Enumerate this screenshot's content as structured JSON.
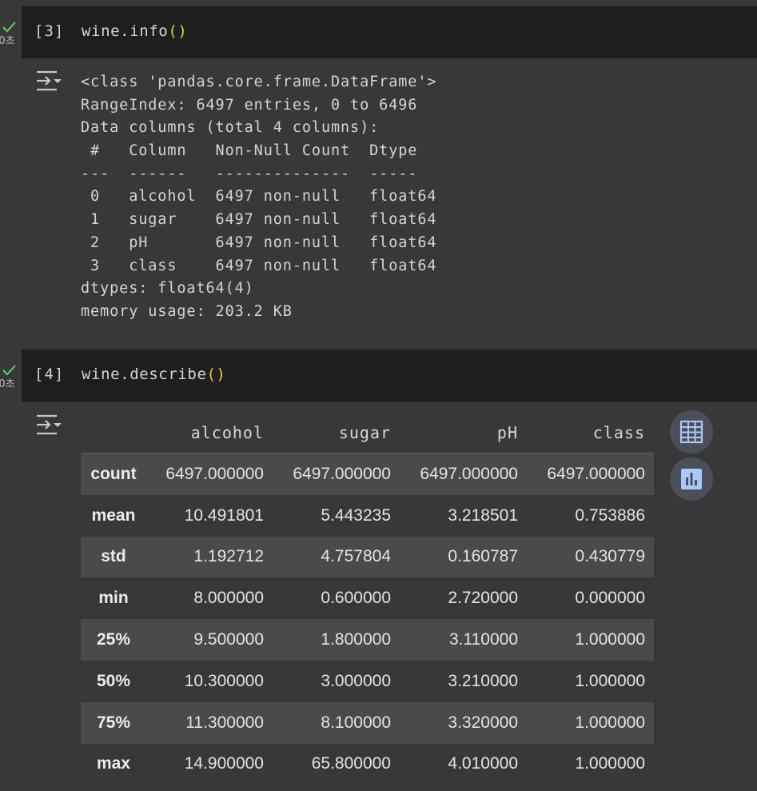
{
  "cells": [
    {
      "exec_count": "[3]",
      "exec_time": "0초",
      "code": {
        "prefix": "wine.info",
        "parens": "()"
      },
      "output_lines": [
        "<class 'pandas.core.frame.DataFrame'>",
        "RangeIndex: 6497 entries, 0 to 6496",
        "Data columns (total 4 columns):",
        " #   Column   Non-Null Count  Dtype  ",
        "---  ------   --------------  -----  ",
        " 0   alcohol  6497 non-null   float64",
        " 1   sugar    6497 non-null   float64",
        " 2   pH       6497 non-null   float64",
        " 3   class    6497 non-null   float64",
        "dtypes: float64(4)",
        "memory usage: 203.2 KB"
      ]
    },
    {
      "exec_count": "[4]",
      "exec_time": "0초",
      "code": {
        "prefix": "wine.describe",
        "parens": "()"
      }
    }
  ],
  "describe_table": {
    "columns": [
      "alcohol",
      "sugar",
      "pH",
      "class"
    ],
    "rows": [
      {
        "label": "count",
        "values": [
          "6497.000000",
          "6497.000000",
          "6497.000000",
          "6497.000000"
        ]
      },
      {
        "label": "mean",
        "values": [
          "10.491801",
          "5.443235",
          "3.218501",
          "0.753886"
        ]
      },
      {
        "label": "std",
        "values": [
          "1.192712",
          "4.757804",
          "0.160787",
          "0.430779"
        ]
      },
      {
        "label": "min",
        "values": [
          "8.000000",
          "0.600000",
          "2.720000",
          "0.000000"
        ]
      },
      {
        "label": "25%",
        "values": [
          "9.500000",
          "1.800000",
          "3.110000",
          "1.000000"
        ]
      },
      {
        "label": "50%",
        "values": [
          "10.300000",
          "3.000000",
          "3.210000",
          "1.000000"
        ]
      },
      {
        "label": "75%",
        "values": [
          "11.300000",
          "8.100000",
          "3.320000",
          "1.000000"
        ]
      },
      {
        "label": "max",
        "values": [
          "14.900000",
          "65.800000",
          "4.010000",
          "1.000000"
        ]
      }
    ]
  },
  "icons": {
    "status": "check-icon",
    "output_toggle": "output-collapse-icon",
    "table_button": "table-grid-icon",
    "chart_button": "bar-chart-icon"
  },
  "colors": {
    "check": "#5fd35f",
    "paren": "#f5c341",
    "button_bg": "#4b4f57",
    "button_icon": "#a8c7fa"
  }
}
